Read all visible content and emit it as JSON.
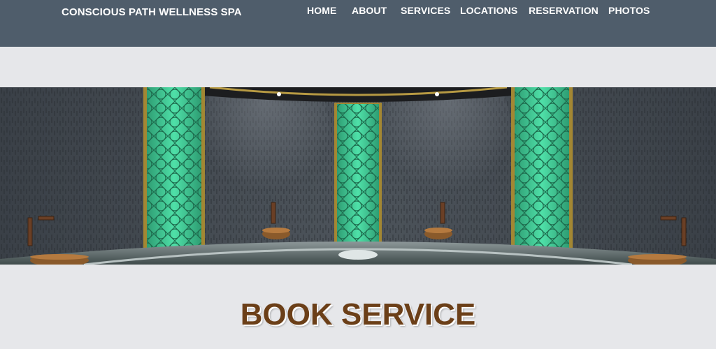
{
  "header": {
    "brand": "CONSCIOUS PATH WELLNESS SPA",
    "nav": [
      "HOME",
      "ABOUT",
      "SERVICES",
      "LOCATIONS",
      "RESERVATION",
      "PHOTOS"
    ]
  },
  "hero": {
    "image_alt": "Turkish hammam interior with green mosaic panels and copper basins"
  },
  "main": {
    "section_title": "BOOK SERVICE"
  },
  "colors": {
    "header_bg": "#4f5d6b",
    "page_bg": "#e6e7ea",
    "title_color": "#6b3f18",
    "mosaic_green": "#3fcf98"
  }
}
